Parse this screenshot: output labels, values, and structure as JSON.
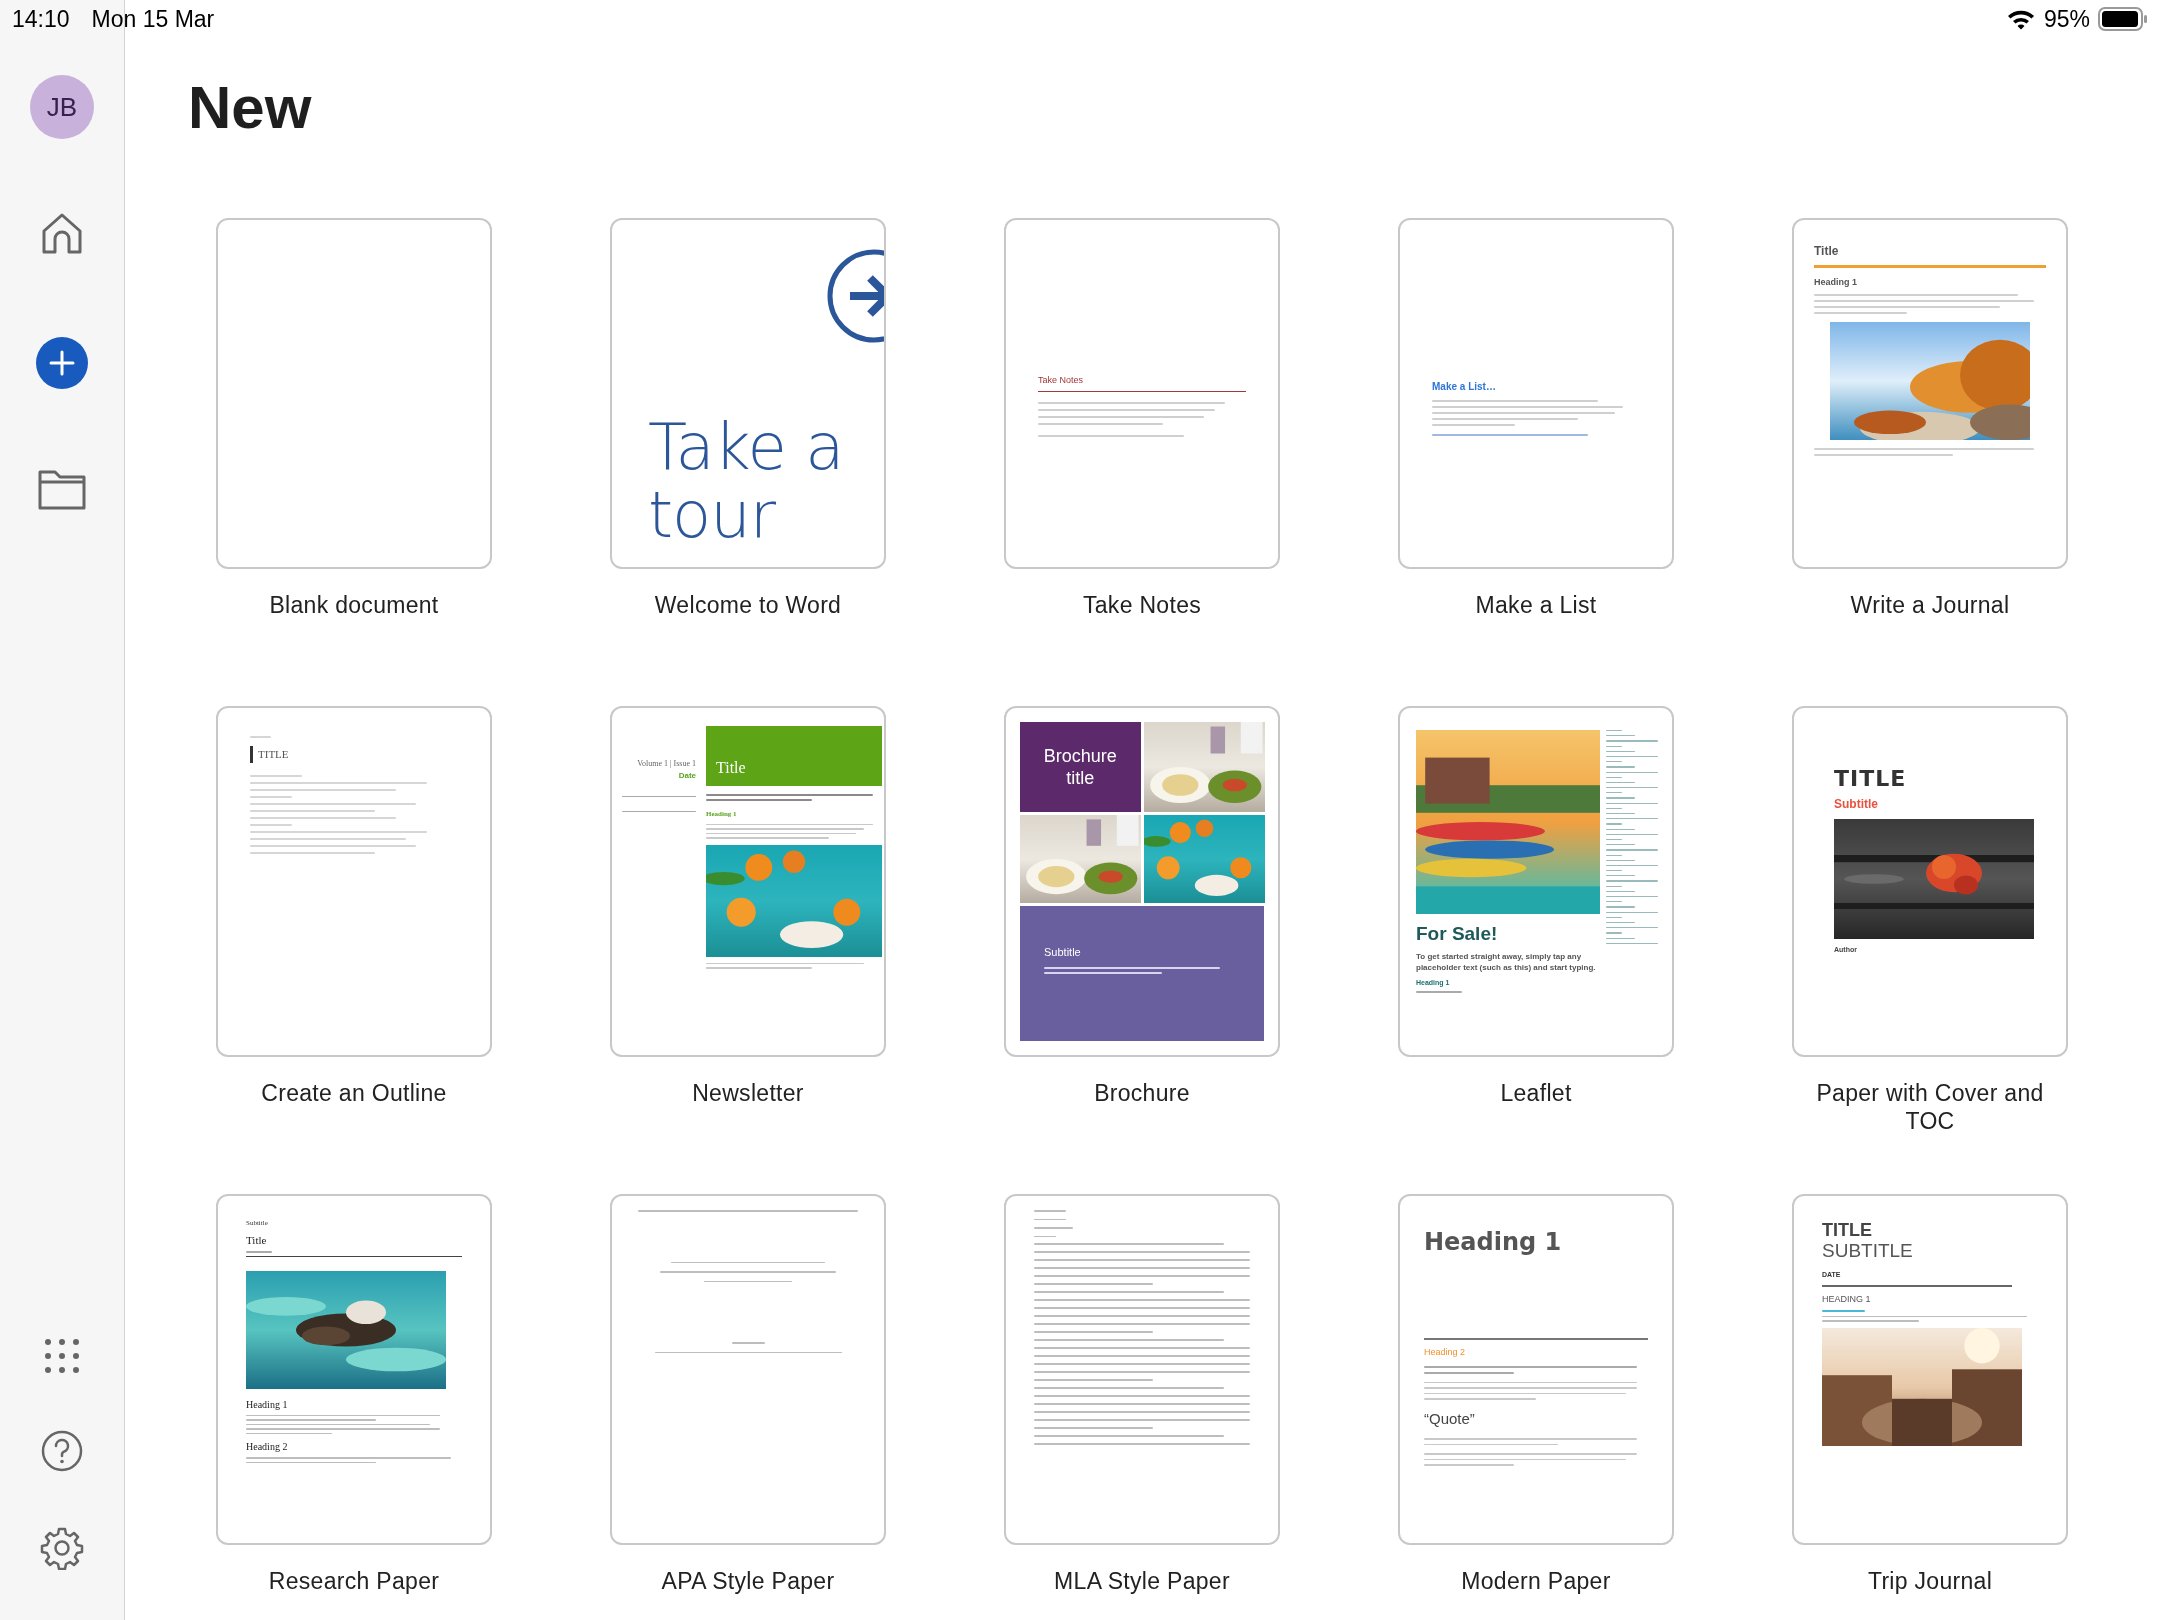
{
  "status_bar": {
    "time": "14:10",
    "date": "Mon 15 Mar",
    "battery": "95%"
  },
  "sidebar": {
    "avatar": "JB",
    "items": [
      {
        "kind": "home",
        "selected": false
      },
      {
        "kind": "new",
        "selected": true
      },
      {
        "kind": "folder",
        "selected": false
      }
    ],
    "bottom": [
      {
        "kind": "apps"
      },
      {
        "kind": "help"
      },
      {
        "kind": "settings"
      }
    ]
  },
  "title": "New",
  "templates": [
    {
      "name": "Blank document",
      "kind": "blank"
    },
    {
      "name": "Welcome to Word",
      "kind": "tour",
      "texts": [
        "Take a tour"
      ]
    },
    {
      "name": "Take Notes",
      "kind": "notes",
      "texts": [
        "Take Notes"
      ]
    },
    {
      "name": "Make a List",
      "kind": "list",
      "texts": [
        "Make a List…"
      ]
    },
    {
      "name": "Write a Journal",
      "kind": "journal",
      "texts": [
        "Title",
        "Heading 1"
      ]
    },
    {
      "name": "Create an Outline",
      "kind": "outline",
      "texts": [
        "TITLE"
      ]
    },
    {
      "name": "Newsletter",
      "kind": "newsletter",
      "texts": [
        "Volume 1 | Issue 1",
        "Date",
        "Title",
        "Heading 1"
      ]
    },
    {
      "name": "Brochure",
      "kind": "brochure",
      "texts": [
        "Brochure title",
        "Subtitle"
      ]
    },
    {
      "name": "Leaflet",
      "kind": "leaflet",
      "texts": [
        "For Sale!",
        "To get started straight away, simply tap any placeholder text (such as this) and start typing.",
        "Heading 1"
      ]
    },
    {
      "name": "Paper with Cover and TOC",
      "kind": "cover",
      "texts": [
        "TITLE",
        "Subtitle",
        "Author"
      ]
    },
    {
      "name": "Research Paper",
      "kind": "research",
      "texts": [
        "Subtitle",
        "Title",
        "Heading 1",
        "Heading 2"
      ]
    },
    {
      "name": "APA Style Paper",
      "kind": "apa"
    },
    {
      "name": "MLA Style Paper",
      "kind": "mla"
    },
    {
      "name": "Modern Paper",
      "kind": "modern",
      "texts": [
        "Heading 1",
        "Heading 2",
        "“Quote”"
      ]
    },
    {
      "name": "Trip Journal",
      "kind": "trip",
      "texts": [
        "TITLE",
        "SUBTITLE",
        "DATE",
        "HEADING 1"
      ]
    }
  ]
}
